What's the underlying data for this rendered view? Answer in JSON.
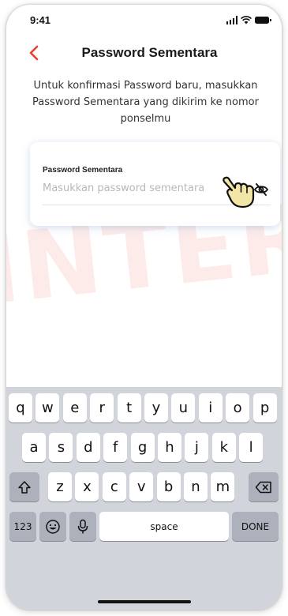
{
  "status_bar": {
    "time": "9:41"
  },
  "header": {
    "title": "Password Sementara"
  },
  "subtitle": "Untuk konfirmasi Password baru, masukkan Password Sementara yang dikirim ke nomor ponselmu",
  "form": {
    "label": "Password Sementara",
    "value": "",
    "placeholder": "Masukkan password sementara"
  },
  "watermark": "INTERNAL",
  "colors": {
    "accent": "#E8412F",
    "watermark": "#F04A3A",
    "keyboard_bg": "#D1D4DA",
    "key_dark": "#ACB1BB"
  },
  "keyboard": {
    "row1": [
      "q",
      "w",
      "e",
      "r",
      "t",
      "y",
      "u",
      "i",
      "o",
      "p"
    ],
    "row2": [
      "a",
      "s",
      "d",
      "f",
      "g",
      "h",
      "j",
      "k",
      "l"
    ],
    "row3": [
      "z",
      "x",
      "c",
      "v",
      "b",
      "n",
      "m"
    ],
    "numbers_key": "123",
    "space_key": "space",
    "done_key": "DONE"
  },
  "icons": [
    "back-chevron-icon",
    "eye-off-icon",
    "hand-pointer-icon",
    "shift-icon",
    "backspace-icon",
    "emoji-icon",
    "microphone-icon"
  ]
}
